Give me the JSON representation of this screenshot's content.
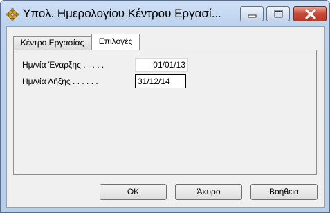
{
  "window": {
    "title": "Υπολ. Ημερολογίου Κέντρου Εργασί..."
  },
  "tabs": [
    {
      "label": "Κέντρο Εργασίας",
      "selected": false
    },
    {
      "label": "Επιλογές",
      "selected": true
    }
  ],
  "form": {
    "start_date_label": "Ημ/νία Έναρξης . . . . .",
    "start_date_value": "01/01/13",
    "end_date_label": "Ημ/νία Λήξης . . . . . .",
    "end_date_value": "31/12/14"
  },
  "buttons": {
    "ok": "OK",
    "cancel": "Άκυρο",
    "help": "Βοήθεια"
  },
  "colors": {
    "titlebar": "#bcd3ee",
    "close_button": "#c94a36"
  },
  "icons": [
    "gear-icon",
    "minimize-icon",
    "maximize-icon",
    "close-icon"
  ]
}
